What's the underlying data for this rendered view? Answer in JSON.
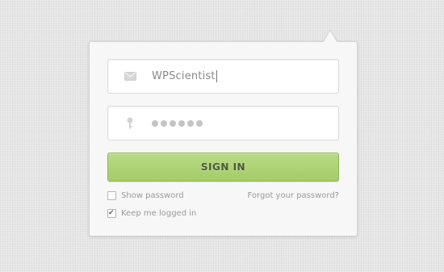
{
  "login": {
    "username_value": "WPScientist",
    "password_masked_count": 6,
    "signin_label": "SIGN IN",
    "show_password_label": "Show password",
    "show_password_checked": false,
    "keep_logged_in_label": "Keep me logged in",
    "keep_logged_in_checked": true,
    "forgot_label": "Forgot your password?"
  },
  "icons": {
    "username": "envelope-icon",
    "password": "key-icon",
    "checkmark": "checkmark-icon"
  },
  "colors": {
    "accent": "#a8d070",
    "text_muted": "#9a9a9a",
    "background": "#e6e6e6"
  }
}
